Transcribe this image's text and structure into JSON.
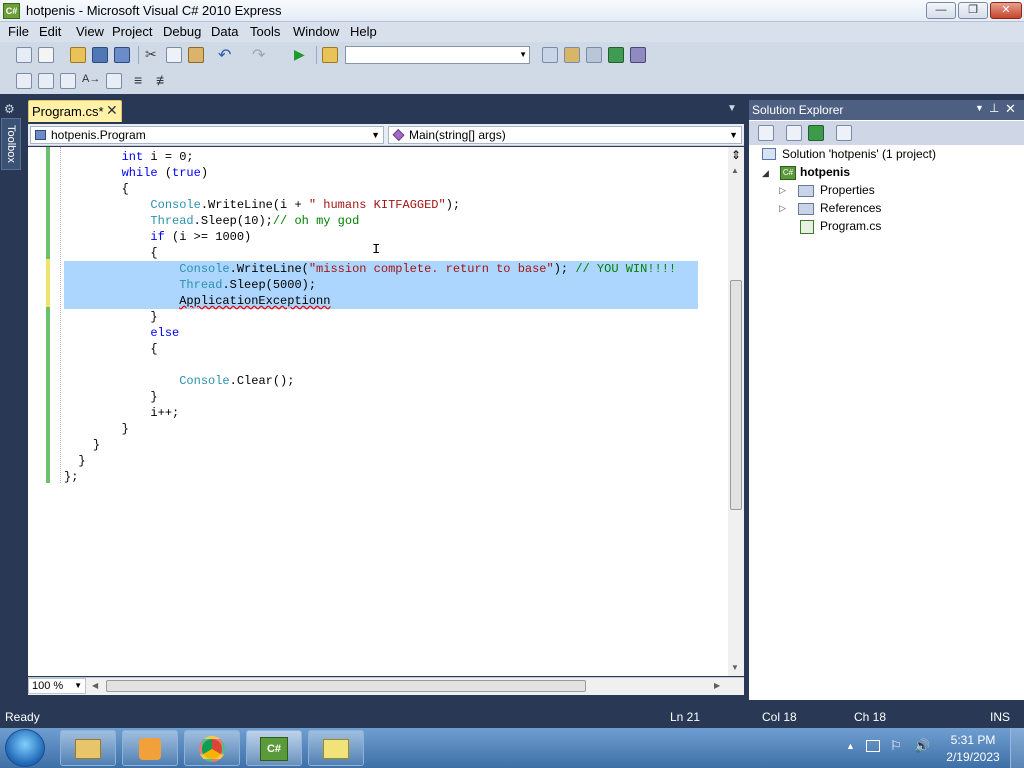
{
  "window": {
    "title": "hotpenis - Microsoft Visual C# 2010 Express",
    "app_icon": "C#"
  },
  "menu": [
    "File",
    "Edit",
    "View",
    "Project",
    "Debug",
    "Data",
    "Tools",
    "Window",
    "Help"
  ],
  "toolbar": {
    "config_value": ""
  },
  "tabs": [
    {
      "label": "Program.cs*",
      "active": true
    }
  ],
  "toolbox_label": "Toolbox",
  "nav": {
    "class_combo": "hotpenis.Program",
    "member_combo": "Main(string[] args)"
  },
  "code_lines": [
    {
      "indent": "        ",
      "segments": [
        {
          "t": "int",
          "c": "kw"
        },
        {
          "t": " i = 0;",
          "c": ""
        }
      ]
    },
    {
      "indent": "        ",
      "segments": [
        {
          "t": "while",
          "c": "kw"
        },
        {
          "t": " (",
          "c": ""
        },
        {
          "t": "true",
          "c": "kw"
        },
        {
          "t": ")",
          "c": ""
        }
      ]
    },
    {
      "indent": "        ",
      "segments": [
        {
          "t": "{",
          "c": ""
        }
      ]
    },
    {
      "indent": "            ",
      "segments": [
        {
          "t": "Console",
          "c": "ty"
        },
        {
          "t": ".WriteLine(i + ",
          "c": ""
        },
        {
          "t": "\" humans KITFAGGED\"",
          "c": "st"
        },
        {
          "t": ");",
          "c": ""
        }
      ]
    },
    {
      "indent": "            ",
      "segments": [
        {
          "t": "Thread",
          "c": "ty"
        },
        {
          "t": ".Sleep(10);",
          "c": ""
        },
        {
          "t": "// oh my god",
          "c": "cm"
        }
      ]
    },
    {
      "indent": "            ",
      "segments": [
        {
          "t": "if",
          "c": "kw"
        },
        {
          "t": " (i >= 1000)",
          "c": ""
        }
      ]
    },
    {
      "indent": "            ",
      "segments": [
        {
          "t": "{",
          "c": ""
        }
      ]
    },
    {
      "indent": "                ",
      "segments": [
        {
          "t": "Console",
          "c": "ty"
        },
        {
          "t": ".WriteLine(",
          "c": ""
        },
        {
          "t": "\"mission complete. return to base\"",
          "c": "st"
        },
        {
          "t": "); ",
          "c": ""
        },
        {
          "t": "// YOU WIN!!!!",
          "c": "cm"
        }
      ],
      "selected": true
    },
    {
      "indent": "                ",
      "segments": [
        {
          "t": "Thread",
          "c": "ty"
        },
        {
          "t": ".Sleep(5000);",
          "c": ""
        }
      ],
      "selected": true
    },
    {
      "indent": "                ",
      "segments": [
        {
          "t": "ApplicationExceptionn",
          "c": ""
        }
      ],
      "selected": true
    },
    {
      "indent": "            ",
      "segments": [
        {
          "t": "}",
          "c": ""
        }
      ]
    },
    {
      "indent": "            ",
      "segments": [
        {
          "t": "else",
          "c": "kw"
        }
      ]
    },
    {
      "indent": "            ",
      "segments": [
        {
          "t": "{",
          "c": ""
        }
      ]
    },
    {
      "indent": "",
      "segments": [
        {
          "t": "",
          "c": ""
        }
      ]
    },
    {
      "indent": "                ",
      "segments": [
        {
          "t": "Console",
          "c": "ty"
        },
        {
          "t": ".Clear();",
          "c": ""
        }
      ]
    },
    {
      "indent": "            ",
      "segments": [
        {
          "t": "}",
          "c": ""
        }
      ]
    },
    {
      "indent": "            ",
      "segments": [
        {
          "t": "i++;",
          "c": ""
        }
      ]
    },
    {
      "indent": "        ",
      "segments": [
        {
          "t": "}",
          "c": ""
        }
      ]
    },
    {
      "indent": "    ",
      "segments": [
        {
          "t": "}",
          "c": ""
        }
      ]
    },
    {
      "indent": "  ",
      "segments": [
        {
          "t": "}",
          "c": ""
        }
      ]
    },
    {
      "indent": "",
      "segments": [
        {
          "t": "};",
          "c": ""
        }
      ]
    }
  ],
  "zoom": "100 %",
  "solution_explorer": {
    "title": "Solution Explorer",
    "solution": "Solution 'hotpenis' (1 project)",
    "project": "hotpenis",
    "items": [
      "Properties",
      "References",
      "Program.cs"
    ]
  },
  "status": {
    "text": "Ready",
    "ln": "Ln 21",
    "col": "Col 18",
    "ch": "Ch 18",
    "mode": "INS"
  },
  "taskbar": {
    "time": "5:31 PM",
    "date": "2/19/2023"
  }
}
